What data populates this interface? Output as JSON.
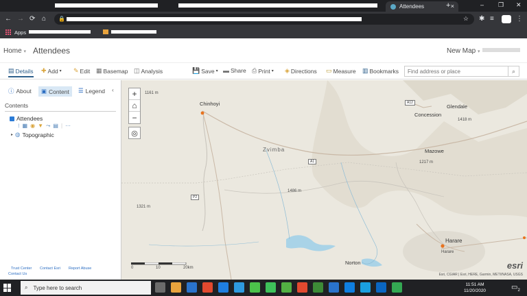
{
  "browser": {
    "tab_title": "Attendees",
    "new_tab": "+",
    "tab_close": "×",
    "window_controls": [
      "–",
      "❐",
      "✕"
    ],
    "bookmarks": {
      "apps_label": "Apps"
    }
  },
  "app_header": {
    "home": "Home",
    "title": "Attendees",
    "new_map": "New Map"
  },
  "toolbar": {
    "details": "Details",
    "add": "Add",
    "edit": "Edit",
    "basemap": "Basemap",
    "analysis": "Analysis",
    "save": "Save",
    "share": "Share",
    "print": "Print",
    "directions": "Directions",
    "measure": "Measure",
    "bookmarks": "Bookmarks",
    "search_placeholder": "Find address or place"
  },
  "left_panel": {
    "tabs": {
      "about": "About",
      "content": "Content",
      "legend": "Legend"
    },
    "contents_heading": "Contents",
    "layers": [
      {
        "name": "Attendees",
        "checked": true
      }
    ],
    "basemap_layer": "Topographic",
    "footer_links": [
      "Trust Center",
      "Contact Esri",
      "Report Abuse",
      "Contact Us"
    ]
  },
  "map": {
    "places": {
      "chinhoyi": "Chinhoyi",
      "zvimba": "Zvimba",
      "concession": "Concession",
      "glendale": "Glendale",
      "mazowe": "Mazowe",
      "harare_large": "Harare",
      "harare_small": "Harare",
      "norton": "Norton"
    },
    "roads": {
      "a1": "A1",
      "a12": "A12",
      "p2": "P2"
    },
    "elevations": {
      "e1": "1161 m",
      "e2": "1486 m",
      "e3": "1321 m",
      "e4": "1418 m",
      "e5": "1217 m"
    },
    "scale": {
      "zero": "0",
      "ten": "10",
      "twenty": "20km"
    },
    "attribution": "Esri, CGIAR | Esri, HERE, Garmin, METI/NASA, USGS",
    "logo": "esri",
    "zoom_in": "+",
    "zoom_out": "−"
  },
  "taskbar": {
    "search_placeholder": "Type here to search",
    "time": "11:51 AM",
    "date": "11/20/2020",
    "notifications": "2",
    "app_colors": [
      "#6b6b6b",
      "#e8a33d",
      "#2a73cc",
      "#e2492f",
      "#1f7ee0",
      "#2e9ae0",
      "#4cc24b",
      "#3ec25a",
      "#52b043",
      "#e2492f",
      "#3d8b37",
      "#2a73cc",
      "#0f7ee0",
      "#1aa0e0",
      "#0a66c2",
      "#34a853"
    ]
  }
}
